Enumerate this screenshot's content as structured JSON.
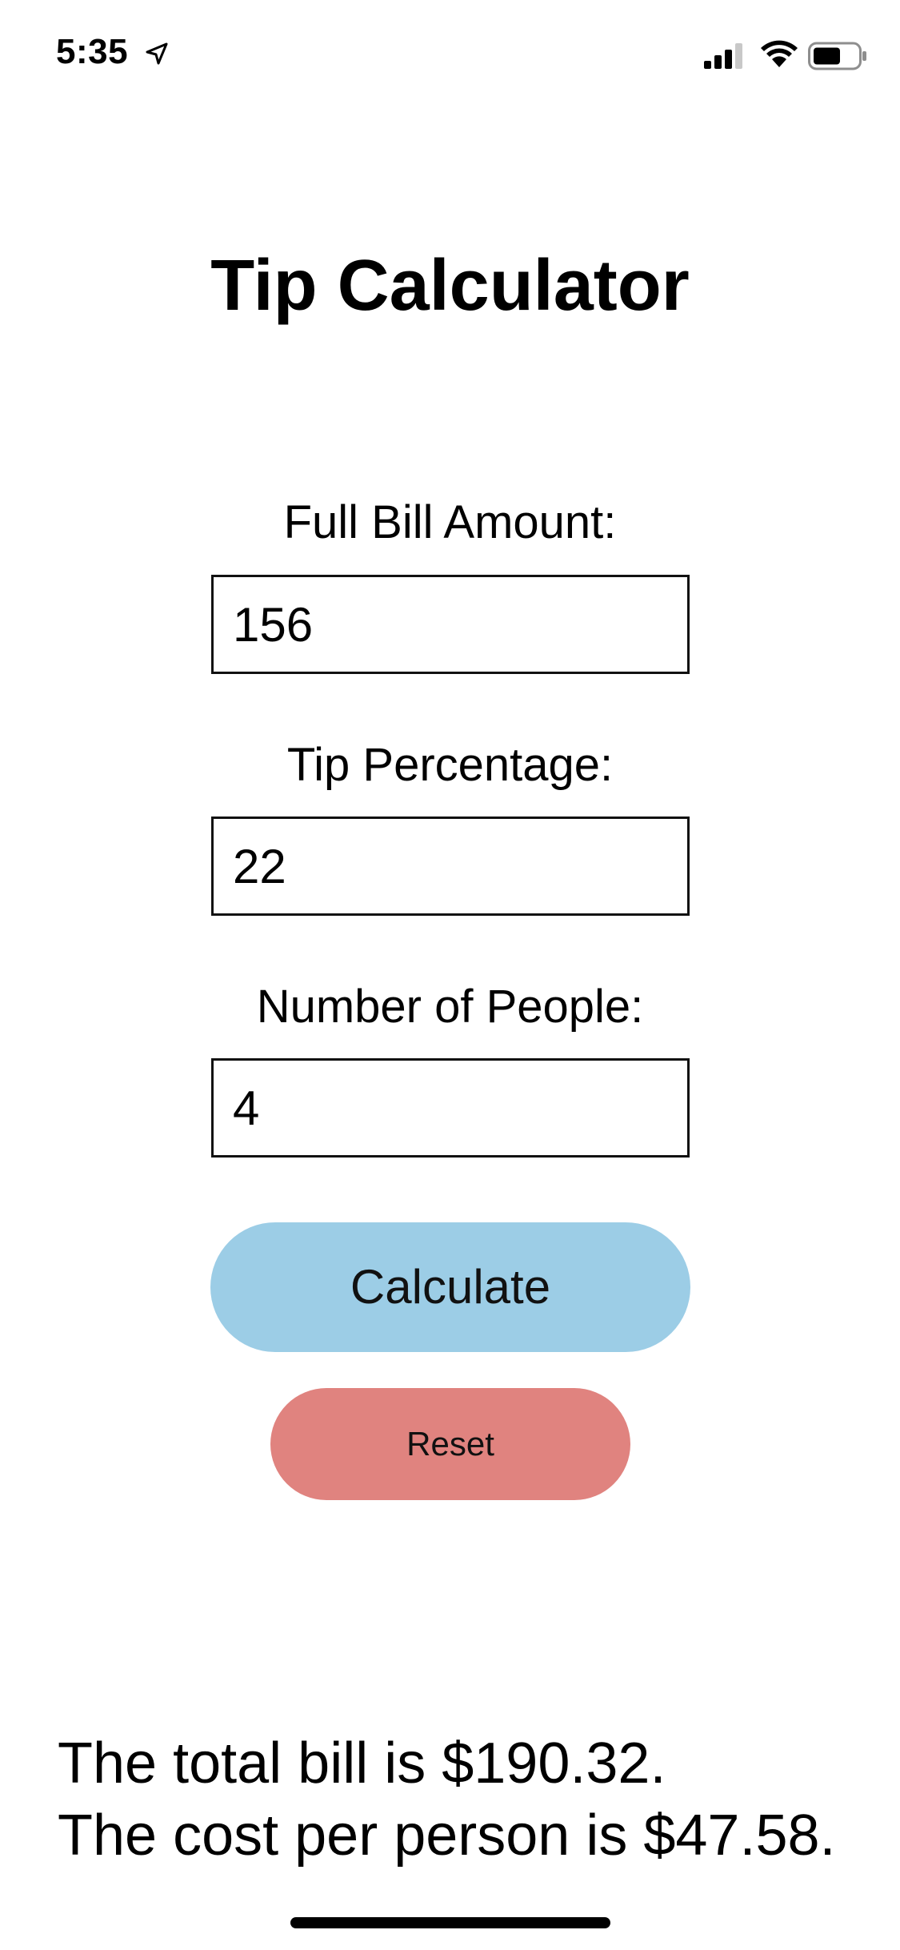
{
  "status_bar": {
    "time": "5:35",
    "icons": [
      "location-arrow-icon",
      "cellular-signal-icon",
      "wifi-icon",
      "battery-icon"
    ]
  },
  "title": "Tip Calculator",
  "fields": [
    {
      "label": "Full Bill Amount:",
      "value": "156"
    },
    {
      "label": "Tip Percentage:",
      "value": "22"
    },
    {
      "label": "Number of People:",
      "value": "4"
    }
  ],
  "buttons": {
    "calculate": "Calculate",
    "reset": "Reset"
  },
  "results": {
    "total_line": "The total bill is $190.32.",
    "per_person_line": "The cost per person is $47.58."
  },
  "colors": {
    "calculate_button": "#9ccde6",
    "reset_button": "#e0837f",
    "text": "#000000",
    "background": "#ffffff"
  }
}
